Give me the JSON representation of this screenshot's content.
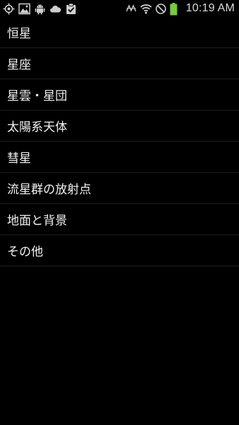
{
  "status_bar": {
    "left_icons": [
      "gps-icon",
      "gallery-icon",
      "android-icon",
      "cloud-icon",
      "clipboard-check-icon"
    ],
    "right_icons": [
      "nfc-icon",
      "wifi-icon",
      "blocked-icon",
      "battery-icon"
    ],
    "time": "10:19 AM",
    "battery_color": "#7ac943"
  },
  "list": {
    "items": [
      {
        "label": "恒星"
      },
      {
        "label": "星座"
      },
      {
        "label": "星雲・星団"
      },
      {
        "label": "太陽系天体"
      },
      {
        "label": "彗星"
      },
      {
        "label": "流星群の放射点"
      },
      {
        "label": "地面と背景"
      },
      {
        "label": "その他"
      }
    ]
  }
}
